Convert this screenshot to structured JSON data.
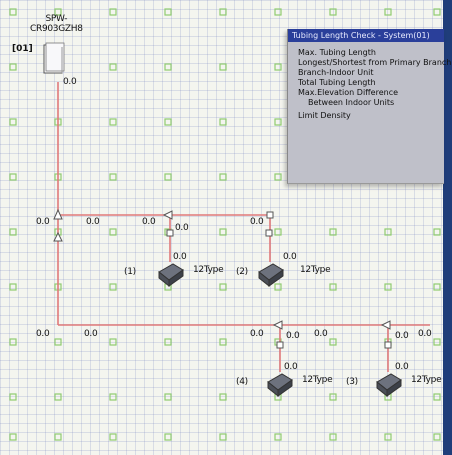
{
  "outdoor_unit": {
    "model": "SPW-\nCR903GZH8",
    "tag": "[01]",
    "tubing": "0.0"
  },
  "panel": {
    "title": "Tubing Length Check - System(01)",
    "items": [
      "Max. Tubing Length",
      "Longest/Shortest from Primary Branch",
      "Branch-Indoor Unit",
      "Total Tubing Length",
      "Max.Elevation Difference",
      "Between Indoor Units",
      "Limit Density"
    ]
  },
  "tubing_lengths": [
    "0.0",
    "0.0",
    "0.0",
    "0.0",
    "0.0",
    "0.0",
    "0.0",
    "0.0",
    "0.0",
    "0.0",
    "0.0",
    "0.0"
  ],
  "indoor_units": [
    {
      "id": "(1)",
      "type": "12Type",
      "tubing": "0.0"
    },
    {
      "id": "(2)",
      "type": "12Type",
      "tubing": "0.0"
    },
    {
      "id": "(4)",
      "type": "12Type",
      "tubing": "0.0"
    },
    {
      "id": "(3)",
      "type": "12Type",
      "tubing": "0.0"
    }
  ],
  "colors": {
    "pipe": "#e07a7a",
    "grid_node": "#8fcc70",
    "panel_title": "#2a3f9a",
    "panel_bg": "#bfc0c9"
  }
}
